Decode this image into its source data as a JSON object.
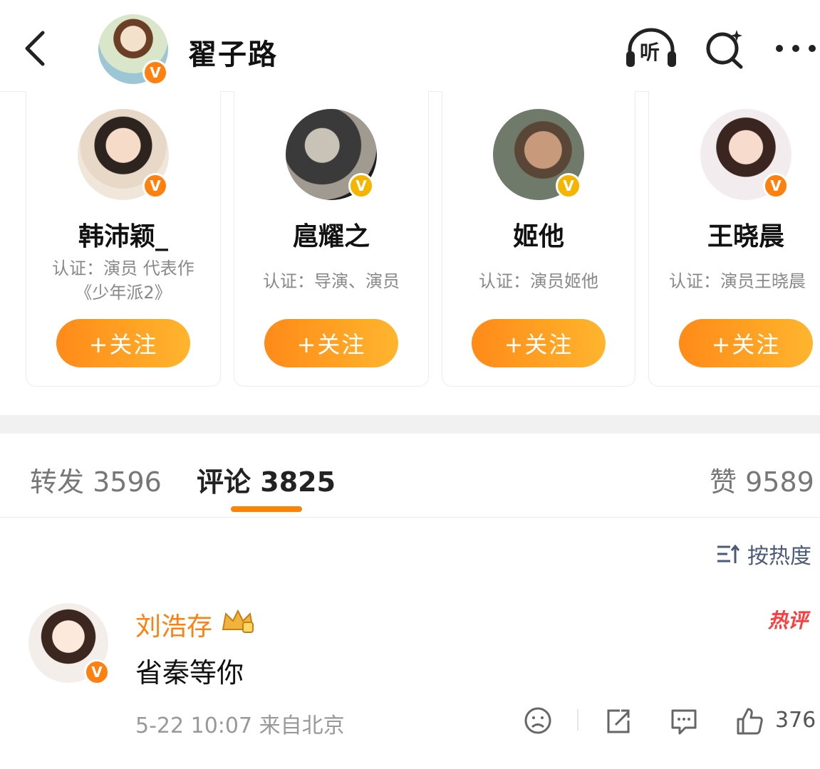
{
  "header": {
    "title": "翟子路",
    "listen_label": "听"
  },
  "cards": [
    {
      "name": "韩沛颖_",
      "desc_line1": "认证：演员 代表作",
      "desc_line2": "《少年派2》",
      "follow_label": "+关注"
    },
    {
      "name": "扈耀之",
      "desc_line1": "认证：导演、演员",
      "follow_label": "+关注"
    },
    {
      "name": "姬他",
      "desc_line1": "认证：演员姬他",
      "follow_label": "+关注"
    },
    {
      "name": "王晓晨",
      "desc_line1": "认证：演员王晓晨",
      "follow_label": "+关注"
    }
  ],
  "tabs": {
    "repost_label": "转发",
    "repost_count": "3596",
    "comment_label": "评论",
    "comment_count": "3825",
    "like_label": "赞",
    "like_count": "9589"
  },
  "sort": {
    "label": "按热度"
  },
  "comment": {
    "author": "刘浩存",
    "hot_badge": "热评",
    "text": "省秦等你",
    "time": "5-22 10:07",
    "source": "来自北京",
    "like_count": "376"
  },
  "colors": {
    "accent": "#ff8200",
    "verified_gold": "#f5b400",
    "verified_orange": "#ff7f0f",
    "hot": "#ff3b3b"
  },
  "icons": [
    "back-icon",
    "listen-icon",
    "search-icon",
    "more-icon",
    "verified-badge-icon",
    "crown-icon",
    "sort-icon",
    "dislike-face-icon",
    "share-icon",
    "comment-icon",
    "like-icon"
  ]
}
